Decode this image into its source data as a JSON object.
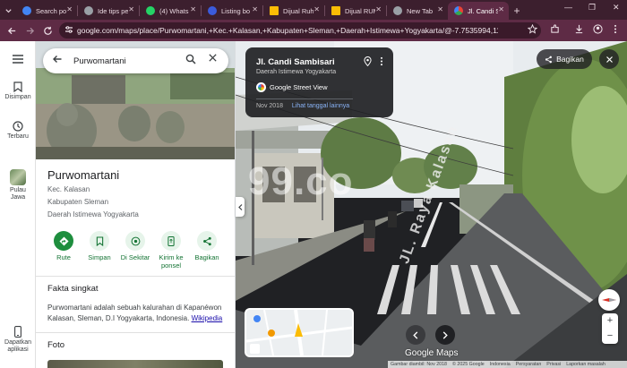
{
  "browser": {
    "tabs": [
      {
        "title": "Search po",
        "color": "#4285f4"
      },
      {
        "title": "Ide tips pe",
        "color": "#9aa0a6"
      },
      {
        "title": "(4) Whats",
        "color": "#25d366"
      },
      {
        "title": "Listing bo",
        "color": "#3b5bdb"
      },
      {
        "title": "Dijual Ruh",
        "color": "#fbbc05"
      },
      {
        "title": "Dijual RUM",
        "color": "#fbbc05"
      },
      {
        "title": "New Tab",
        "color": "#9aa0a6"
      },
      {
        "title": "Jl. Candi S",
        "color": "#34a853",
        "active": true
      }
    ],
    "new_tab_label": "+",
    "url": "google.com/maps/place/Purwomartani,+Kec.+Kalasan,+Kabupaten+Sleman,+Daerah+Istimewa+Yogyakarta/@-7.7535994,110.4482595,3a,..."
  },
  "rail": {
    "menu_icon": "menu-icon",
    "saved_label": "Disimpan",
    "recent_label": "Terbaru",
    "island_label": "Pulau Jawa",
    "apps_label": "Dapatkan aplikasi"
  },
  "search": {
    "query": "Purwomartani"
  },
  "place": {
    "name": "Purwomartani",
    "lines": [
      "Kec. Kalasan",
      "Kabupaten Sleman",
      "Daerah Istimewa Yogyakarta"
    ],
    "actions": [
      {
        "label": "Rute",
        "icon": "directions-icon"
      },
      {
        "label": "Simpan",
        "icon": "bookmark-icon"
      },
      {
        "label": "Di Sekitar",
        "icon": "nearby-icon"
      },
      {
        "label": "Kirim ke ponsel",
        "icon": "send-to-phone-icon"
      },
      {
        "label": "Bagikan",
        "icon": "share-icon"
      }
    ],
    "facts_title": "Fakta singkat",
    "facts_text": "Purwomartani adalah sebuah kalurahan di Kapanéwon Kalasan, Sleman, D.I Yogyakarta, Indonesia.",
    "facts_link": "Wikipedia",
    "photos_title": "Foto"
  },
  "streetview": {
    "street": "Jl. Candi Sambisari",
    "region": "Daerah Istimewa Yogyakarta",
    "service": "Google Street View",
    "date": "Nov 2018",
    "older_link": "Lihat tanggal lainnya",
    "share_label": "Bagikan",
    "logo": "Google Maps",
    "watermark": "99.co",
    "road_text": "JL. Raya Kalasan",
    "attribution": [
      "Gambar diambil: Nov 2018",
      "© 2025 Google",
      "Indonesia",
      "Persyaratan",
      "Privasi",
      "Laporkan masalah"
    ],
    "zoom_in": "+",
    "zoom_out": "−"
  },
  "colors": {
    "tab_bg": "#3c1f2e",
    "toolbar_bg": "#5e2b45",
    "accent_green": "#137333",
    "action_fill": "#e6f4ea"
  }
}
